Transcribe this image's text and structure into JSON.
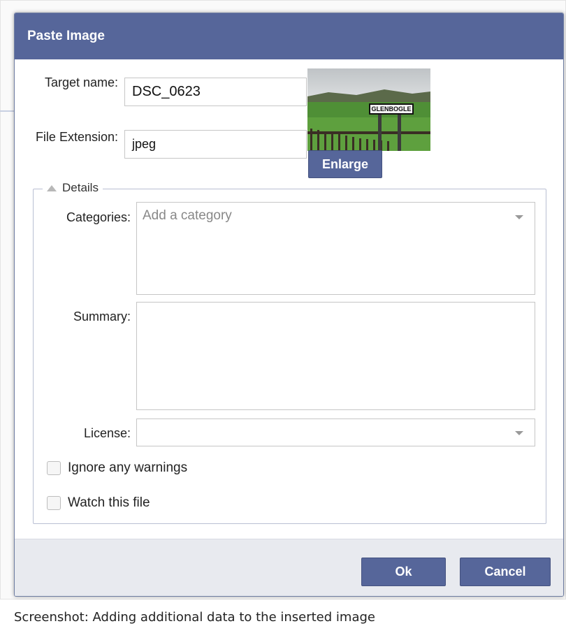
{
  "dialog": {
    "title": "Paste Image",
    "target_name_label": "Target name:",
    "target_name_value": "DSC_0623",
    "file_ext_label": "File Extension:",
    "file_ext_value": "jpeg",
    "thumbnail_sign_text": "GLENBOGLE",
    "enlarge_label": "Enlarge",
    "details_label": "Details",
    "categories_label": "Categories:",
    "categories_placeholder": "Add a category",
    "summary_label": "Summary:",
    "license_label": "License:",
    "ignore_warnings_label": "Ignore any warnings",
    "watch_file_label": "Watch this file",
    "ok_label": "Ok",
    "cancel_label": "Cancel"
  },
  "caption": "Screenshot: Adding additional data to the inserted image",
  "colors": {
    "titlebar": "#56669a",
    "button": "#56669a",
    "footer": "#e8eaef"
  }
}
